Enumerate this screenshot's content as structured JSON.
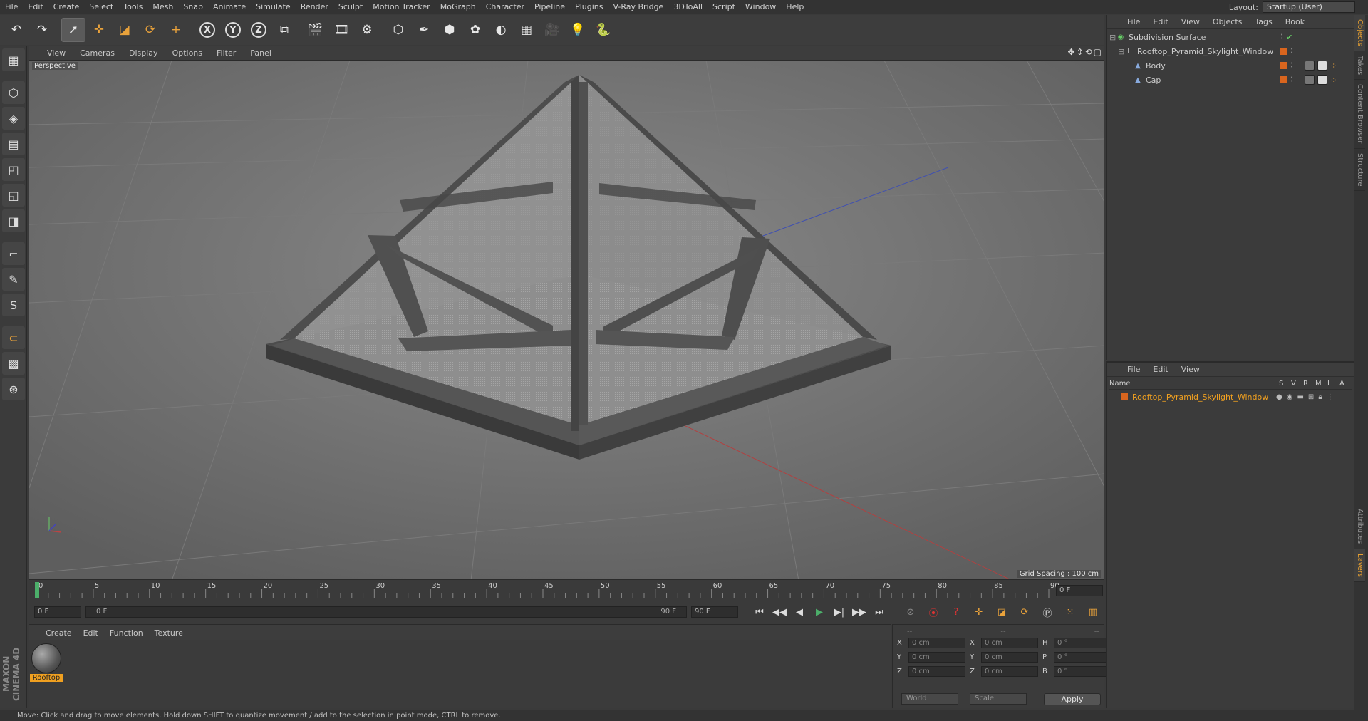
{
  "menubar": {
    "items": [
      "File",
      "Edit",
      "Create",
      "Select",
      "Tools",
      "Mesh",
      "Snap",
      "Animate",
      "Simulate",
      "Render",
      "Sculpt",
      "Motion Tracker",
      "MoGraph",
      "Character",
      "Pipeline",
      "Plugins",
      "V-Ray Bridge",
      "3DToAll",
      "Script",
      "Window",
      "Help"
    ],
    "layout_label": "Layout:",
    "layout_value": "Startup (User)"
  },
  "toolbar": {
    "icons": [
      "undo-icon",
      "redo-icon",
      "select-arrow-icon",
      "move-icon",
      "scale-icon",
      "rotate-icon",
      "add-icon",
      "x-axis-icon",
      "y-axis-icon",
      "z-axis-icon",
      "coordinate-system-icon",
      "render-view-icon",
      "render-picture-viewer-icon",
      "render-settings-icon",
      "cube-icon",
      "pen-icon",
      "subdivide-icon",
      "cloner-icon",
      "deformer-icon",
      "floor-icon",
      "camera-icon",
      "light-icon",
      "python-icon"
    ],
    "glyphs": [
      "↶",
      "↷",
      "➚",
      "✛",
      "◪",
      "⟳",
      "+",
      "X",
      "Y",
      "Z",
      "⧉",
      "🎬",
      "🎞",
      "⚙",
      "⬡",
      "✒",
      "⬢",
      "✿",
      "◐",
      "▦",
      "🎥",
      "💡",
      "🐍"
    ],
    "x_label": "X",
    "y_label": "Y",
    "z_label": "Z"
  },
  "lefttools": {
    "glyphs": [
      "▦",
      "⬡",
      "◈",
      "▤",
      "◰",
      "◱",
      "◨",
      "⌐",
      "✎",
      "S",
      "⊂",
      "▩",
      "⊛"
    ],
    "icons": [
      "make-editable-icon",
      "model-mode-icon",
      "texture-mode-icon",
      "workplane-icon",
      "points-mode-icon",
      "edges-mode-icon",
      "polygons-mode-icon",
      "axis-mode-icon",
      "tweak-mode-icon",
      "snap-icon",
      "magnet-icon",
      "lock-workplane-icon",
      "planar-workplane-icon"
    ]
  },
  "viewport_menu": {
    "items": [
      "View",
      "Cameras",
      "Display",
      "Options",
      "Filter",
      "Panel"
    ]
  },
  "viewport": {
    "label": "Perspective",
    "grid_spacing": "Grid Spacing : 100 cm"
  },
  "timeline": {
    "ticks": [
      "0",
      "5",
      "10",
      "15",
      "20",
      "25",
      "30",
      "35",
      "40",
      "45",
      "50",
      "55",
      "60",
      "65",
      "70",
      "75",
      "80",
      "85",
      "90"
    ],
    "current_frame_display": "0 F"
  },
  "transport": {
    "start_field": "0 F",
    "range_start": "0 F",
    "range_end": "90 F",
    "end_field": "90 F",
    "buttons": [
      "⏮",
      "◀◀",
      "◀",
      "▶",
      "▶|",
      "▶▶",
      "⏭"
    ],
    "icons": [
      "go-start-icon",
      "prev-key-icon",
      "prev-frame-icon",
      "play-icon",
      "next-frame-icon",
      "next-key-icon",
      "go-end-icon"
    ]
  },
  "materials": {
    "menu": [
      "Create",
      "Edit",
      "Function",
      "Texture"
    ],
    "items": [
      {
        "label": "Rooftop"
      }
    ]
  },
  "coords": {
    "header": [
      "--",
      "--",
      "--"
    ],
    "rows": [
      {
        "a_lbl": "X",
        "a_val": "0 cm",
        "b_lbl": "X",
        "b_val": "0 cm",
        "c_lbl": "H",
        "c_val": "0 °"
      },
      {
        "a_lbl": "Y",
        "a_val": "0 cm",
        "b_lbl": "Y",
        "b_val": "0 cm",
        "c_lbl": "P",
        "c_val": "0 °"
      },
      {
        "a_lbl": "Z",
        "a_val": "0 cm",
        "b_lbl": "Z",
        "b_val": "0 cm",
        "c_lbl": "B",
        "c_val": "0 °"
      }
    ],
    "space_value": "World",
    "mode_value": "Scale",
    "apply_label": "Apply"
  },
  "objects": {
    "menu": [
      "File",
      "Edit",
      "View",
      "Objects",
      "Tags",
      "Book"
    ],
    "tree": [
      {
        "name": "Subdivision Surface",
        "level": 0,
        "icon": "subdivision-icon"
      },
      {
        "name": "Rooftop_Pyramid_Skylight_Window",
        "level": 1,
        "icon": "null-object-icon"
      },
      {
        "name": "Body",
        "level": 2,
        "icon": "polygon-object-icon"
      },
      {
        "name": "Cap",
        "level": 2,
        "icon": "polygon-object-icon"
      }
    ]
  },
  "layers": {
    "menu": [
      "File",
      "Edit",
      "View"
    ],
    "columns": [
      "Name",
      "S",
      "V",
      "R",
      "M",
      "L",
      "A"
    ],
    "rows": [
      {
        "name": "Rooftop_Pyramid_Skylight_Window"
      }
    ]
  },
  "sidetabs": [
    "Objects",
    "Takes",
    "Content Browser",
    "Structure",
    "Attributes",
    "Layers"
  ],
  "statusbar": {
    "text": "Move: Click and drag to move elements. Hold down SHIFT to quantize movement / add to the selection in point mode, CTRL to remove."
  },
  "brand": {
    "text": "MAXON CINEMA 4D"
  },
  "colors": {
    "accent": "#f0a020",
    "object_orange": "#d9651e",
    "viewport_bg": "#6e6e6e"
  }
}
